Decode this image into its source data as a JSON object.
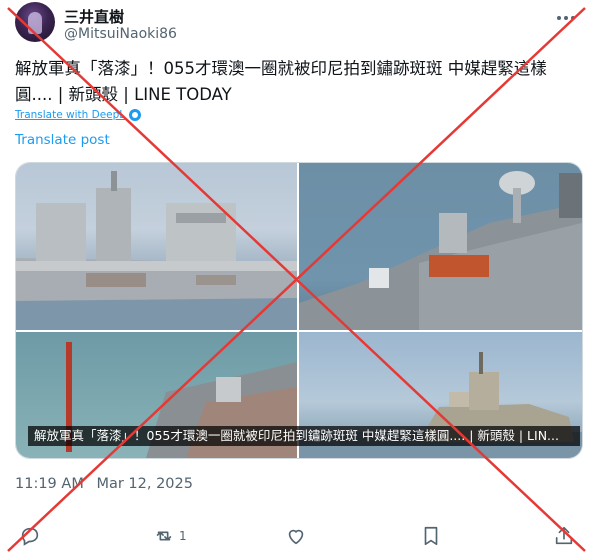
{
  "user": {
    "display_name": "三井直樹",
    "handle": "@MitsuiNaoki86"
  },
  "tweet": {
    "text_line1": "解放軍真「落漆」！055才環澳一圈就被印尼拍到鏽跡斑斑 中媒趕緊這樣",
    "text_line2": "圓.... | 新頭殼 | LINE TODAY",
    "translate_deepl": "Translate with DeepL",
    "translate_post": "Translate post",
    "media_caption": "解放軍真「落漆」！055才環澳一圈就被印尼拍到鏽跡斑斑 中媒趕緊這樣圓.... | 新頭殼 | LIN...",
    "time": "11:19 AM",
    "date": "Mar 12, 2025"
  },
  "actions": {
    "reply_count": "",
    "repost_count": "1",
    "like_count": ""
  },
  "icons": [
    "more-icon",
    "deepl-icon",
    "reply-icon",
    "repost-icon",
    "like-icon",
    "bookmark-icon",
    "share-icon"
  ],
  "colors": {
    "accent": "#1d9bf0",
    "muted": "#536471",
    "cross": "#e53935"
  }
}
